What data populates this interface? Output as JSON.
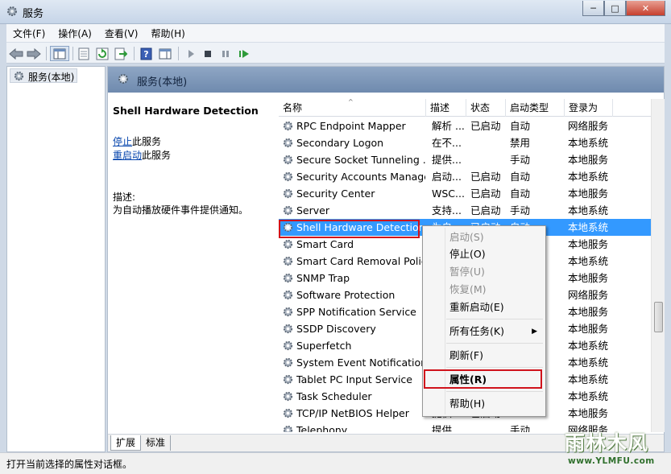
{
  "window": {
    "title": "服务",
    "buttons": [
      "─",
      "□",
      "✕"
    ]
  },
  "menubar": [
    "文件(F)",
    "操作(A)",
    "查看(V)",
    "帮助(H)"
  ],
  "tree": {
    "item": "服务(本地)"
  },
  "main": {
    "header": "服务(本地)",
    "desc": {
      "service_name": "Shell Hardware Detection",
      "stop_link": "停止",
      "stop_rest": "此服务",
      "restart_link": "重启动",
      "restart_rest": "此服务",
      "desc_label": "描述:",
      "desc_text": "为自动播放硬件事件提供通知。"
    },
    "columns": [
      "名称",
      "描述",
      "状态",
      "启动类型",
      "登录为"
    ],
    "rows": [
      {
        "name": "RPC Endpoint Mapper",
        "desc": "解析 ...",
        "status": "已启动",
        "startup": "自动",
        "logon": "网络服务"
      },
      {
        "name": "Secondary Logon",
        "desc": "在不...",
        "status": "",
        "startup": "禁用",
        "logon": "本地系统"
      },
      {
        "name": "Secure Socket Tunneling ...",
        "desc": "提供...",
        "status": "",
        "startup": "手动",
        "logon": "本地服务"
      },
      {
        "name": "Security Accounts Manager",
        "desc": "启动...",
        "status": "已启动",
        "startup": "自动",
        "logon": "本地系统"
      },
      {
        "name": "Security Center",
        "desc": "WSC...",
        "status": "已启动",
        "startup": "自动",
        "logon": "本地服务"
      },
      {
        "name": "Server",
        "desc": "支持...",
        "status": "已启动",
        "startup": "手动",
        "logon": "本地系统"
      },
      {
        "name": "Shell Hardware Detection",
        "desc": "为自...",
        "status": "已启动",
        "startup": "自动",
        "logon": "本地系统"
      },
      {
        "name": "Smart Card",
        "desc": "",
        "status": "",
        "startup": "",
        "logon": "本地服务"
      },
      {
        "name": "Smart Card Removal Policy",
        "desc": "",
        "status": "",
        "startup": "",
        "logon": "本地系统"
      },
      {
        "name": "SNMP Trap",
        "desc": "",
        "status": "",
        "startup": "",
        "logon": "本地服务"
      },
      {
        "name": "Software Protection",
        "desc": "",
        "status": "",
        "startup": "",
        "logon": "网络服务"
      },
      {
        "name": "SPP Notification Service",
        "desc": "",
        "status": "",
        "startup": "",
        "logon": "本地服务"
      },
      {
        "name": "SSDP Discovery",
        "desc": "",
        "status": "",
        "startup": "",
        "logon": "本地服务"
      },
      {
        "name": "Superfetch",
        "desc": "",
        "status": "",
        "startup": "",
        "logon": "本地系统"
      },
      {
        "name": "System Event Notification...",
        "desc": "",
        "status": "",
        "startup": "",
        "logon": "本地系统"
      },
      {
        "name": "Tablet PC Input Service",
        "desc": "",
        "status": "",
        "startup": "",
        "logon": "本地系统"
      },
      {
        "name": "Task Scheduler",
        "desc": "",
        "status": "",
        "startup": "",
        "logon": "本地系统"
      },
      {
        "name": "TCP/IP NetBIOS Helper",
        "desc": "提供...",
        "status": "已启动",
        "startup": "",
        "logon": "本地服务"
      },
      {
        "name": "Telephony",
        "desc": "提供...",
        "status": "",
        "startup": "手动",
        "logon": "网络服务"
      }
    ],
    "tabs": [
      "扩展",
      "标准"
    ]
  },
  "context_menu": {
    "items": [
      "启动(S)",
      "停止(O)",
      "暂停(U)",
      "恢复(M)",
      "重新启动(E)",
      "所有任务(K)",
      "刷新(F)",
      "属性(R)",
      "帮助(H)"
    ]
  },
  "status_bar": "打开当前选择的属性对话框。",
  "watermark": {
    "logo": "雨林木风",
    "url": "www.YLMFU.com"
  },
  "colors": {
    "selection": "#3399ff",
    "highlight_box": "#d0121b"
  }
}
